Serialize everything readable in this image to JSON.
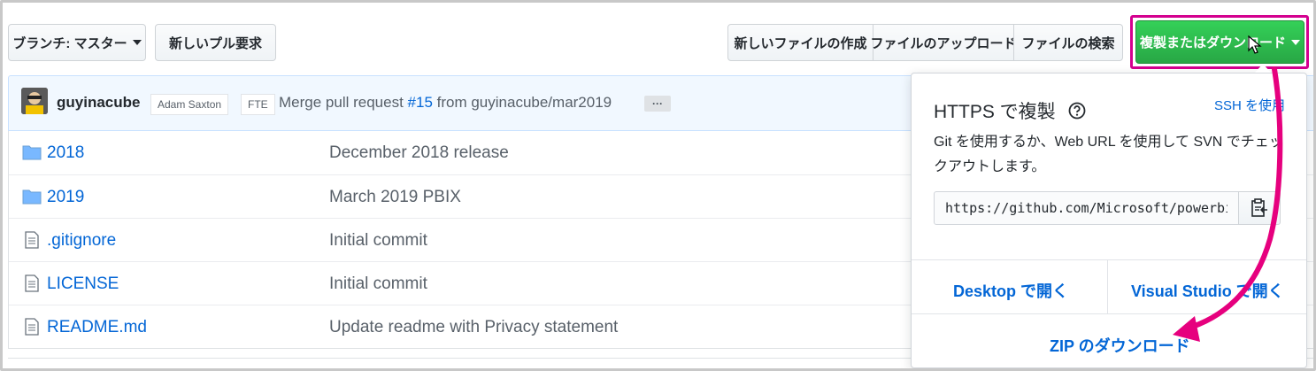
{
  "toolbar": {
    "branch_label": "ブランチ: マスター",
    "new_pr_label": "新しいプル要求",
    "create_file_label": "新しいファイルの作成",
    "upload_label": "ファイルのアップロード",
    "find_file_label": "ファイルの検索",
    "clone_label": "複製またはダウンロード"
  },
  "commit": {
    "author": "guyinacube",
    "coauthor1": "Adam Saxton",
    "coauthor2": "FTE",
    "message_prefix": "Merge pull request ",
    "pr_link": "#15",
    "message_suffix": " from guyinacube/mar2019",
    "ellipsis": "···"
  },
  "files": [
    {
      "icon": "folder-icon",
      "name": "2018",
      "message": "December 2018 release"
    },
    {
      "icon": "folder-icon",
      "name": "2019",
      "message": "March 2019 PBIX"
    },
    {
      "icon": "file-icon",
      "name": ".gitignore",
      "message": "Initial commit"
    },
    {
      "icon": "file-icon",
      "name": "LICENSE",
      "message": "Initial commit"
    },
    {
      "icon": "file-icon",
      "name": "README.md",
      "message": "Update readme with Privacy statement"
    }
  ],
  "clone_dropdown": {
    "title": "HTTPS で複製",
    "ssh_link": "SSH を使用",
    "description": "Git を使用するか、Web URL を使用して SVN でチェックアウトします。",
    "url": "https://github.com/Microsoft/powerbi-desktop-samples.git",
    "open_desktop": "Desktop で開く",
    "open_vs": "Visual Studio で開く",
    "download_zip": "ZIP のダウンロード"
  },
  "colors": {
    "accent_green": "#28a745",
    "link_blue": "#0366d6",
    "annotation_magenta": "#e6007e"
  }
}
